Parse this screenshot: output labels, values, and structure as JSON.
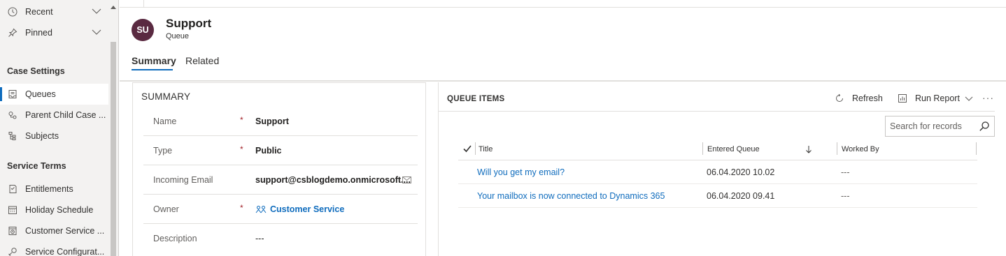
{
  "sidebar": {
    "recent_label": "Recent",
    "pinned_label": "Pinned",
    "section_case_settings": "Case Settings",
    "section_service_terms": "Service Terms",
    "items": [
      {
        "label": "Queues",
        "icon": "queue-icon"
      },
      {
        "label": "Parent Child Case ...",
        "icon": "parent-child-icon"
      },
      {
        "label": "Subjects",
        "icon": "subjects-icon"
      },
      {
        "label": "Entitlements",
        "icon": "entitlements-icon"
      },
      {
        "label": "Holiday Schedule",
        "icon": "calendar-icon"
      },
      {
        "label": "Customer Service ...",
        "icon": "calendar-clock-icon"
      },
      {
        "label": "Service Configurat...",
        "icon": "service-config-icon"
      }
    ],
    "selected_index": 0
  },
  "record": {
    "avatar_initials": "SU",
    "avatar_color": "#5a2a41",
    "title": "Support",
    "entity": "Queue"
  },
  "tabs": {
    "summary": "Summary",
    "related": "Related"
  },
  "summary_section": {
    "heading": "SUMMARY",
    "fields": [
      {
        "label": "Name",
        "required": "*",
        "value": "Support"
      },
      {
        "label": "Type",
        "required": "*",
        "value": "Public"
      },
      {
        "label": "Incoming Email",
        "required": "",
        "value": "support@csblogdemo.onmicrosoft...."
      },
      {
        "label": "Owner",
        "required": "*",
        "value": "Customer Service"
      },
      {
        "label": "Description",
        "required": "",
        "value": "---"
      }
    ]
  },
  "queue_items": {
    "heading": "QUEUE ITEMS",
    "refresh_label": "Refresh",
    "run_report_label": "Run Report",
    "more_label": "···",
    "search_placeholder": "Search for records",
    "columns": {
      "title": "Title",
      "entered_queue": "Entered Queue",
      "worked_by": "Worked By"
    },
    "rows": [
      {
        "title": "Will you get my email?",
        "entered_queue": "06.04.2020 10.02",
        "worked_by": "---"
      },
      {
        "title": "Your mailbox is now connected to Dynamics 365",
        "entered_queue": "06.04.2020 09.41",
        "worked_by": "---"
      }
    ]
  },
  "colors": {
    "accent": "#0f6cbd",
    "required": "#a4262c"
  }
}
